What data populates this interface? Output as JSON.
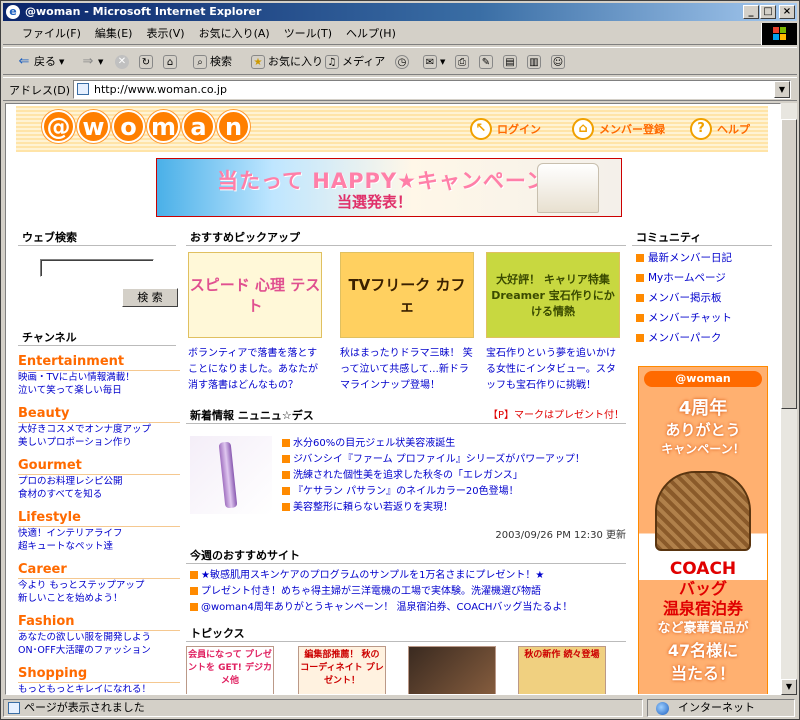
{
  "window": {
    "title": "@woman - Microsoft Internet Explorer",
    "minimize": "_",
    "maximize": "□",
    "close": "×"
  },
  "menu": [
    "ファイル(F)",
    "編集(E)",
    "表示(V)",
    "お気に入り(A)",
    "ツール(T)",
    "ヘルプ(H)"
  ],
  "toolbar": {
    "back": "戻る",
    "search": "検索",
    "favorites": "お気に入り",
    "media": "メディア"
  },
  "address": {
    "label": "アドレス(D)",
    "url": "http://www.woman.co.jp"
  },
  "status": {
    "text": "ページが表示されました",
    "zone": "インターネット"
  },
  "header": {
    "logo_letters": [
      "@",
      "w",
      "o",
      "m",
      "a",
      "n"
    ],
    "login": "ログイン",
    "register": "メンバー登録",
    "help": "ヘルプ"
  },
  "banner": {
    "line1": "当たって HAPPY★キャンペーン",
    "line2": "当選発表！"
  },
  "left": {
    "search_title": "ウェブ検索",
    "search_button": "検 索",
    "channel_title": "チャンネル",
    "channels": [
      {
        "name": "Entertainment",
        "links": [
          "映画・TVに占い情報満載！",
          "泣いて笑って楽しい毎日"
        ]
      },
      {
        "name": "Beauty",
        "links": [
          "大好きコスメでオンナ度アップ",
          "美しいプロポーション作り"
        ]
      },
      {
        "name": "Gourmet",
        "links": [
          "プロのお料理レシピ公開",
          "食材のすべてを知る"
        ]
      },
      {
        "name": "Lifestyle",
        "links": [
          "快適！インテリアライフ",
          "超キュートなペット達"
        ]
      },
      {
        "name": "Career",
        "links": [
          "今より もっとステップアップ",
          "新しいことを始めよう！"
        ]
      },
      {
        "name": "Fashion",
        "links": [
          "あなたの欲しい服を開発しよう",
          "ON･OFF大活躍のファッション"
        ]
      },
      {
        "name": "Shopping",
        "links": [
          "もっともっとキレイになれる！"
        ]
      }
    ]
  },
  "main": {
    "pickup_title": "おすすめピックアップ",
    "pickups": [
      {
        "img": "スピード 心理 テスト",
        "caption": "ボランティアで落書を落とすことになりました。あなたが消す落書はどんなもの？"
      },
      {
        "img": "TVフリーク カフェ",
        "caption": "秋はまったりドラマ三昧！ 笑って泣いて共感して…新ドラマラインナップ登場！"
      },
      {
        "img": "大好評！ キャリア特集 Dreamer 宝石作りにかける情熱",
        "caption": "宝石作りという夢を追いかける女性にインタビュー。スタッフも宝石作りに挑戦！"
      }
    ],
    "news_title": "新着情報 ニュニュ☆デス",
    "news_note": "【P】マークはプレゼント付！",
    "news": [
      "水分60%の目元ジェル状美容液誕生",
      "ジバンシイ『ファーム プロファイル』シリーズがパワーアップ！",
      "洗練された個性美を追求した秋冬の「エレガンス」",
      "『ケサラン パサラン』のネイルカラー20色登場！",
      "美容整形に頼らない若返りを実現！"
    ],
    "news_date": "2003/09/26 PM 12:30 更新",
    "sites_title": "今週のおすすめサイト",
    "sites": [
      "★敏感肌用スキンケアのプログラムのサンプルを1万名さまにプレゼント！★",
      "プレゼント付き！めちゃ得主婦が三洋電機の工場で実体験。洗濯機選び物語",
      "@woman4周年ありがとうキャンペーン！ 温泉宿泊券、COACHバッグ当たるよ！"
    ],
    "topics_title": "トピックス",
    "topics": [
      "会員になって プレゼントを GET! デジカメ他",
      "編集部推薦！ 秋の コーディネイト プレゼント！",
      "",
      "秋の新作 続々登場"
    ]
  },
  "right": {
    "community_title": "コミュニティ",
    "community": [
      "最新メンバー日記",
      "Myホームページ",
      "メンバー掲示板",
      "メンバーチャット",
      "メンバーパーク"
    ],
    "ad": {
      "logo": "@woman",
      "line1": "4周年",
      "line2": "ありがとう",
      "line3": "キャンペーン！",
      "coach": "COACH",
      "bag": "バッグ",
      "onsen": "温泉宿泊券",
      "nado": "など豪華賞品が",
      "count": "47名様に",
      "hit": "当たる！"
    }
  }
}
